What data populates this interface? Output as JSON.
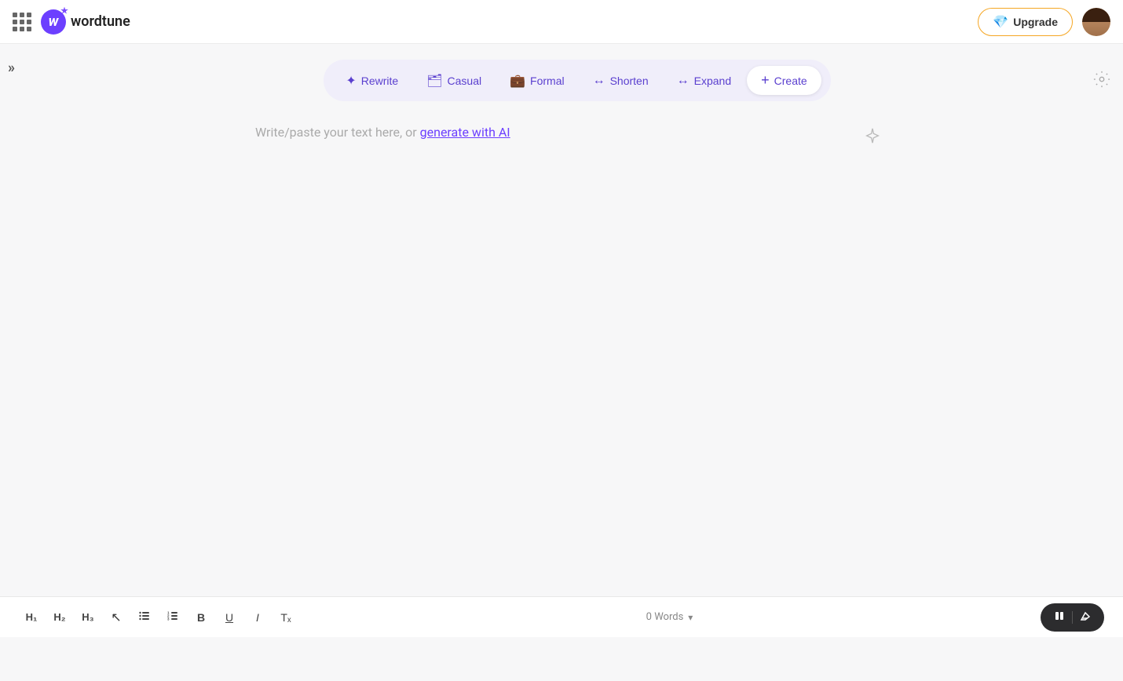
{
  "topnav": {
    "logo_text": "wordtune",
    "upgrade_label": "Upgrade"
  },
  "toolbar": {
    "rewrite_label": "Rewrite",
    "casual_label": "Casual",
    "formal_label": "Formal",
    "shorten_label": "Shorten",
    "expand_label": "Expand",
    "create_label": "Create"
  },
  "editor": {
    "placeholder_text": "Write/paste your text here, or ",
    "generate_link_text": "generate with AI"
  },
  "bottom_toolbar": {
    "h1_label": "H₁",
    "h2_label": "H₂",
    "h3_label": "H₃",
    "bullet_label": "≡",
    "numbered_label": "≡",
    "bold_label": "B",
    "underline_label": "U",
    "italic_label": "I",
    "clear_format_label": "Tₓ",
    "word_count_label": "0 Words"
  },
  "sidebar_toggle": "»"
}
